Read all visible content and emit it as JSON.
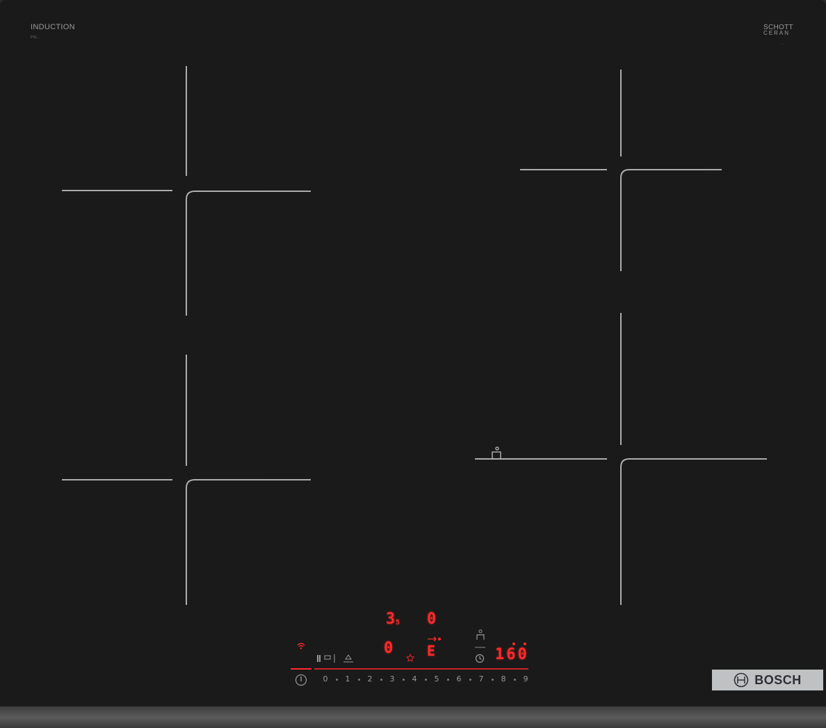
{
  "header": {
    "left_title": "INDUCTION",
    "left_subtitle": "PIE...",
    "right_logo_line1": "SCHOTT",
    "right_logo_line2": "CERAN",
    "right_logo_small": "..."
  },
  "display": {
    "zone_top_left_value": "3",
    "zone_top_left_sub": "5",
    "zone_top_right_value": "0",
    "zone_bottom_left_value": "0",
    "zone_bottom_right_value": "E",
    "timer_value": "160"
  },
  "controls": {
    "power_icon": "power-icon",
    "wifi_icon": "wifi-icon",
    "scale": [
      "0",
      "1",
      "2",
      "3",
      "4",
      "5",
      "6",
      "7",
      "8",
      "9"
    ]
  },
  "brand": {
    "name": "BOSCH",
    "logo_icon": "bosch-logo-icon"
  },
  "colors": {
    "surface": "#1a1a1a",
    "display_red": "#ff2a2a",
    "zone_lines": "#c8c8c8",
    "brand_plate": "#bfc1c3"
  }
}
